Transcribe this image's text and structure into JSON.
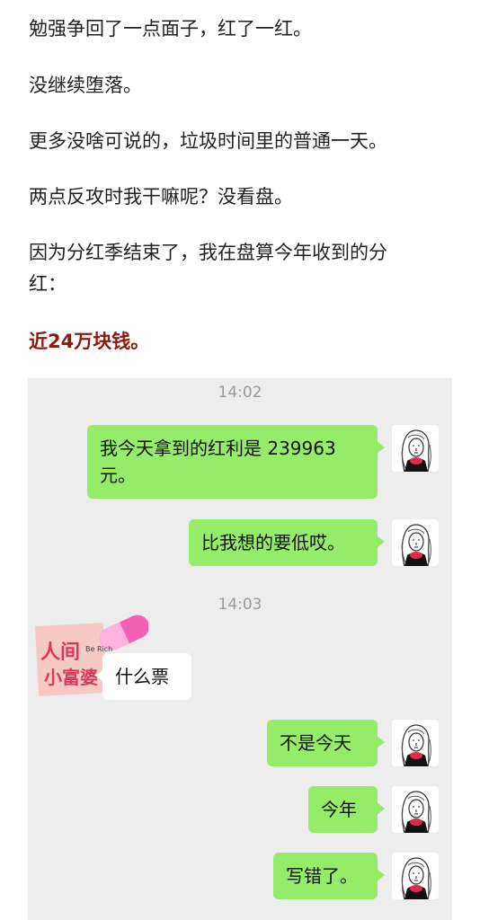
{
  "article": {
    "paragraphs": [
      "勉强争回了一点面子，红了一红。",
      "没继续堕落。",
      "更多没啥可说的，垃圾时间里的普通一天。",
      "两点反攻时我干嘛呢？没看盘。",
      "因为分红季结束了，我在盘算今年收到的分",
      "红："
    ],
    "highlight": "近24万块钱。",
    "highlight_color": "#8b1a0f"
  },
  "chat": {
    "background": "#ededed",
    "times": [
      "14:02",
      "14:03"
    ],
    "messages": [
      {
        "side": "right",
        "lines": [
          "我今天拿到的红利是 239963",
          "元。"
        ]
      },
      {
        "side": "right",
        "text": "比我想的要低哎。"
      },
      {
        "side": "left",
        "text": "什么票",
        "sticker": {
          "line1": "人间",
          "line2": "小富婆",
          "tag": "Be Rich",
          "icon": "pink-pill-sticker"
        }
      },
      {
        "side": "right",
        "text": "不是今天"
      },
      {
        "side": "right",
        "text": "今年"
      },
      {
        "side": "right",
        "text": "写错了。"
      }
    ],
    "self_avatar_icon": "sketch-portrait-avatar",
    "bubble_color": "#95ec69"
  }
}
